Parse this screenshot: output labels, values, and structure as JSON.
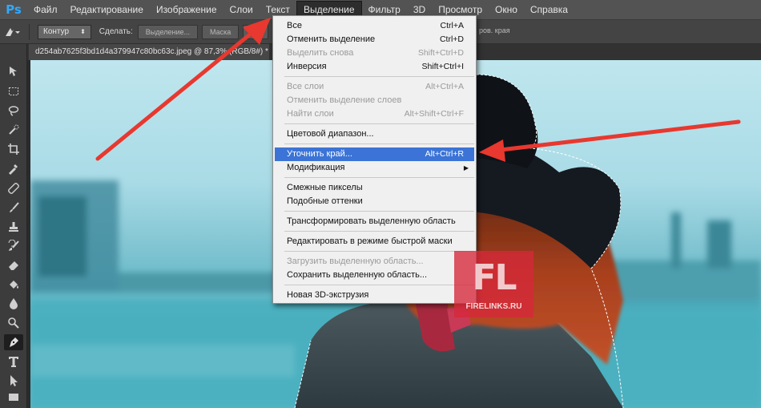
{
  "app": {
    "logo": "Ps"
  },
  "menubar": {
    "items": [
      "Файл",
      "Редактирование",
      "Изображение",
      "Слои",
      "Текст",
      "Выделение",
      "Фильтр",
      "3D",
      "Просмотр",
      "Окно",
      "Справка"
    ],
    "active": "Выделение"
  },
  "options": {
    "mode": "Контур",
    "make_label": "Сделать:",
    "selection_btn": "Выделение...",
    "mask_btn": "Маска",
    "shape_btn": "Фи",
    "right_text": "ров. края"
  },
  "document": {
    "tab_title": "d254ab7625f3bd1d4a379947c80bc63c.jpeg @ 87,3% (RGB/8#) *"
  },
  "dropdown": {
    "items": [
      {
        "label": "Все",
        "shortcut": "Ctrl+A",
        "disabled": false
      },
      {
        "label": "Отменить выделение",
        "shortcut": "Ctrl+D",
        "disabled": false
      },
      {
        "label": "Выделить снова",
        "shortcut": "Shift+Ctrl+D",
        "disabled": true
      },
      {
        "label": "Инверсия",
        "shortcut": "Shift+Ctrl+I",
        "disabled": false
      },
      {
        "label": "Все слои",
        "shortcut": "Alt+Ctrl+A",
        "disabled": true
      },
      {
        "label": "Отменить выделение слоев",
        "shortcut": "",
        "disabled": true
      },
      {
        "label": "Найти слои",
        "shortcut": "Alt+Shift+Ctrl+F",
        "disabled": true
      },
      {
        "label": "Цветовой диапазон...",
        "shortcut": "",
        "disabled": false
      },
      {
        "label": "Уточнить край...",
        "shortcut": "Alt+Ctrl+R",
        "disabled": false,
        "highlighted": true
      },
      {
        "label": "Модификация",
        "shortcut": "",
        "disabled": false,
        "submenu": true
      },
      {
        "label": "Смежные пикселы",
        "shortcut": "",
        "disabled": false
      },
      {
        "label": "Подобные оттенки",
        "shortcut": "",
        "disabled": false
      },
      {
        "label": "Трансформировать выделенную область",
        "shortcut": "",
        "disabled": false
      },
      {
        "label": "Редактировать в режиме быстрой маски",
        "shortcut": "",
        "disabled": false
      },
      {
        "label": "Загрузить выделенную область...",
        "shortcut": "",
        "disabled": true
      },
      {
        "label": "Сохранить выделенную область...",
        "shortcut": "",
        "disabled": false
      },
      {
        "label": "Новая 3D-экструзия",
        "shortcut": "",
        "disabled": false
      }
    ]
  },
  "watermark": {
    "big": "FL",
    "small": "FIRELINKS.RU"
  },
  "colors": {
    "menu_bg": "#535353",
    "highlight": "#3b74d6",
    "arrow": "#e8382f",
    "watermark": "#d6283a"
  }
}
